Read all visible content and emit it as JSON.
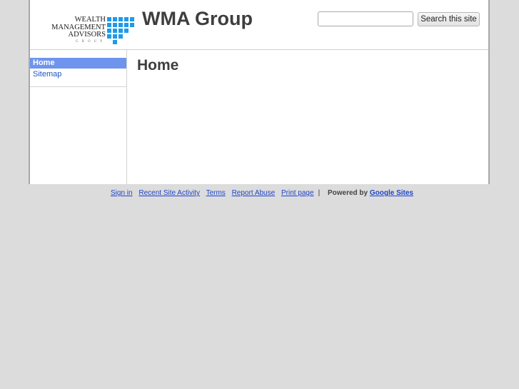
{
  "header": {
    "logo": {
      "line1": "WEALTH",
      "line2": "MANAGEMENT",
      "line3": "ADVISORS",
      "line4": "GROUP",
      "grid_color": "#1e9be8"
    },
    "site_title": "WMA Group",
    "search": {
      "value": "",
      "button_label": "Search this site"
    }
  },
  "sidebar": {
    "items": [
      {
        "label": "Home",
        "selected": true
      },
      {
        "label": "Sitemap",
        "selected": false
      }
    ]
  },
  "main": {
    "page_title": "Home"
  },
  "footer": {
    "links": [
      "Sign in",
      "Recent Site Activity",
      "Terms",
      "Report Abuse",
      "Print page"
    ],
    "separator": "|",
    "powered_by": "Powered by",
    "brand_link": "Google Sites"
  },
  "colors": {
    "nav_selected_bg": "#6e94ee",
    "link": "#1f45c8",
    "page_bg": "#dcdcdc"
  }
}
